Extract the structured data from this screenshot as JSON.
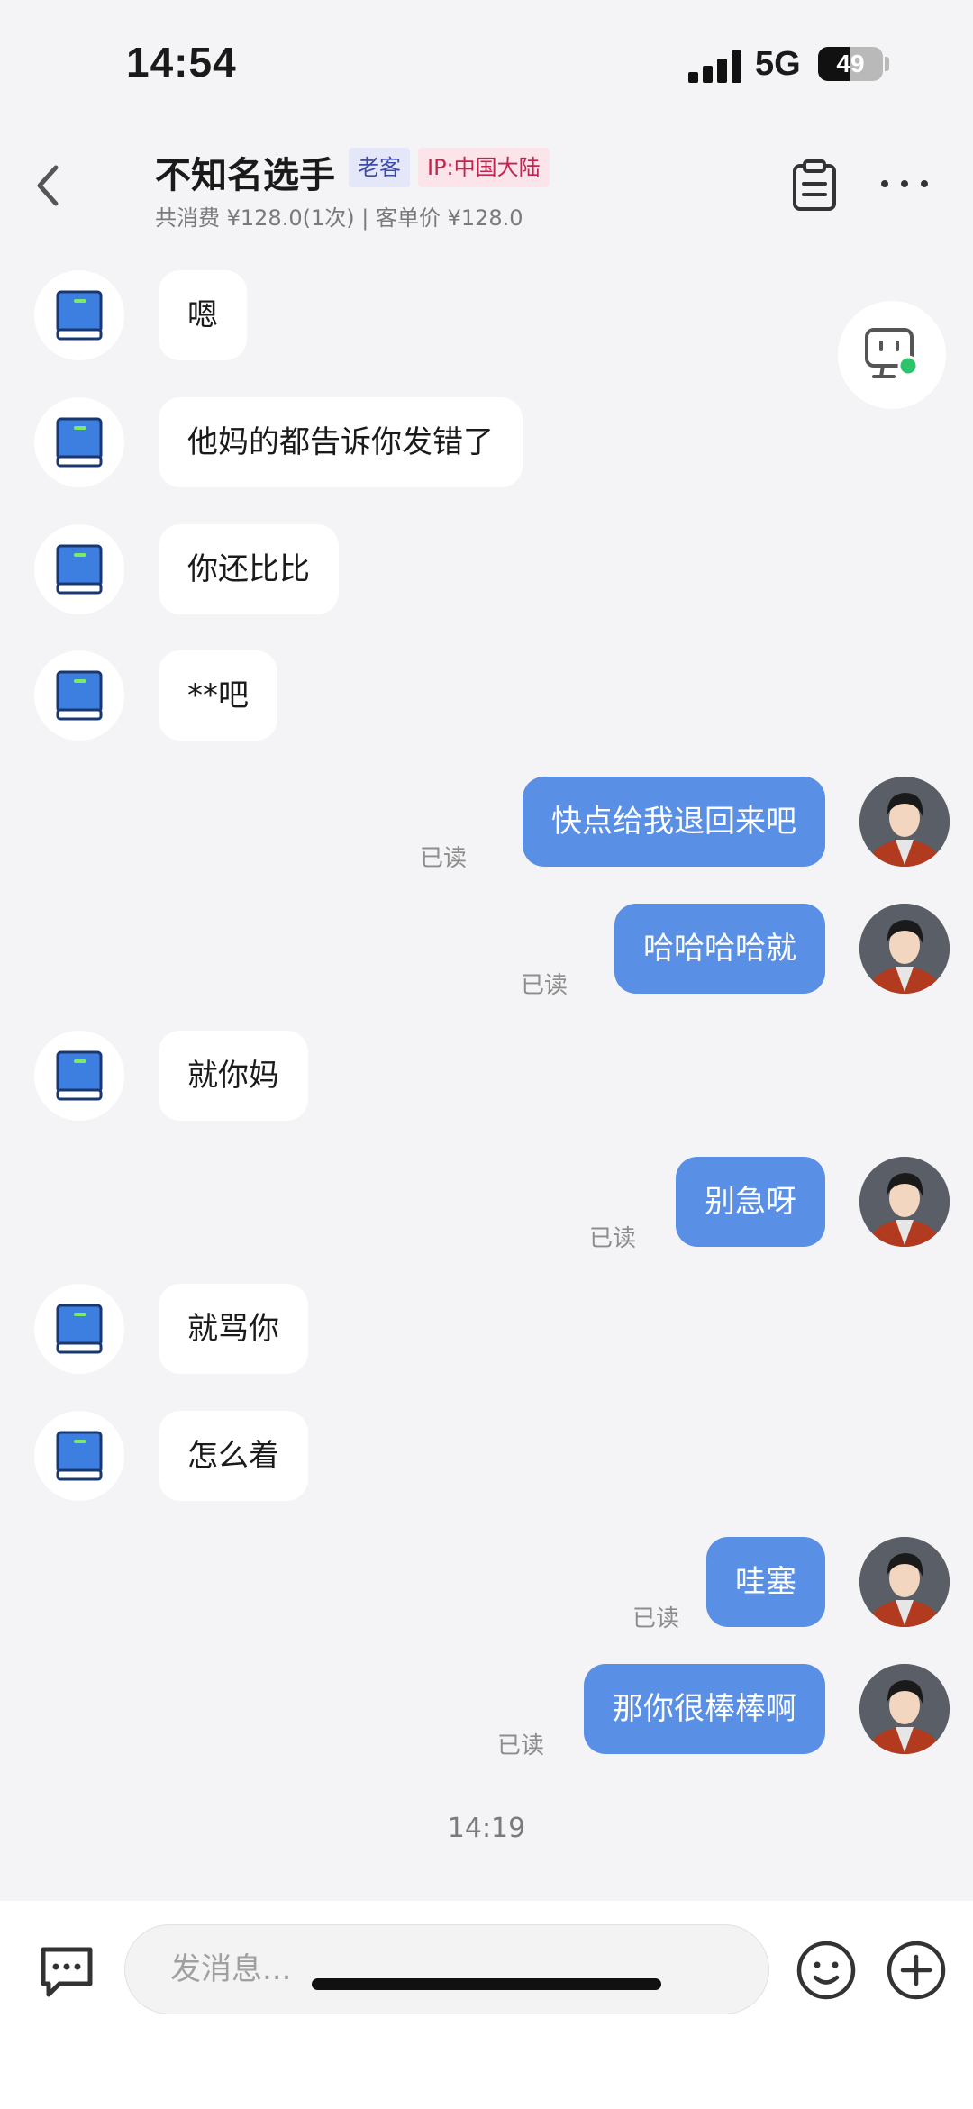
{
  "status_bar": {
    "time": "14:54",
    "network": "5G",
    "battery": "49",
    "battery_level": 0.49
  },
  "header": {
    "name": "不知名选手",
    "tags": [
      "老客",
      "IP:中国大陆"
    ],
    "spend": "共消费 ¥128.0(1次) | 客单价 ¥128.0"
  },
  "messages": [
    {
      "side": "left",
      "text": "嗯"
    },
    {
      "side": "left",
      "text": "他妈的都告诉你发错了"
    },
    {
      "side": "left",
      "text": "你还比比"
    },
    {
      "side": "left",
      "text": "**吧"
    },
    {
      "side": "right",
      "text": "快点给我退回来吧",
      "status": "已读"
    },
    {
      "side": "right",
      "text": "哈哈哈哈就",
      "status": "已读"
    },
    {
      "side": "left",
      "text": "就你妈"
    },
    {
      "side": "right",
      "text": "别急呀",
      "status": "已读"
    },
    {
      "side": "left",
      "text": "就骂你"
    },
    {
      "side": "left",
      "text": "怎么着"
    },
    {
      "side": "right",
      "text": "哇塞",
      "status": "已读"
    },
    {
      "side": "right",
      "text": "那你很棒棒啊",
      "status": "已读"
    }
  ],
  "timestamp": "14:19",
  "input": {
    "placeholder": "发消息..."
  },
  "colors": {
    "outgoing_bubble": "#5a8fe6",
    "incoming_bubble": "#ffffff",
    "background": "#f4f4f6",
    "online_dot": "#2bc46b"
  },
  "icons": [
    "back-icon",
    "clipboard-icon",
    "more-icon",
    "assistant-bot-icon",
    "book-avatar-icon",
    "compose-icon",
    "emoji-icon",
    "plus-icon"
  ]
}
